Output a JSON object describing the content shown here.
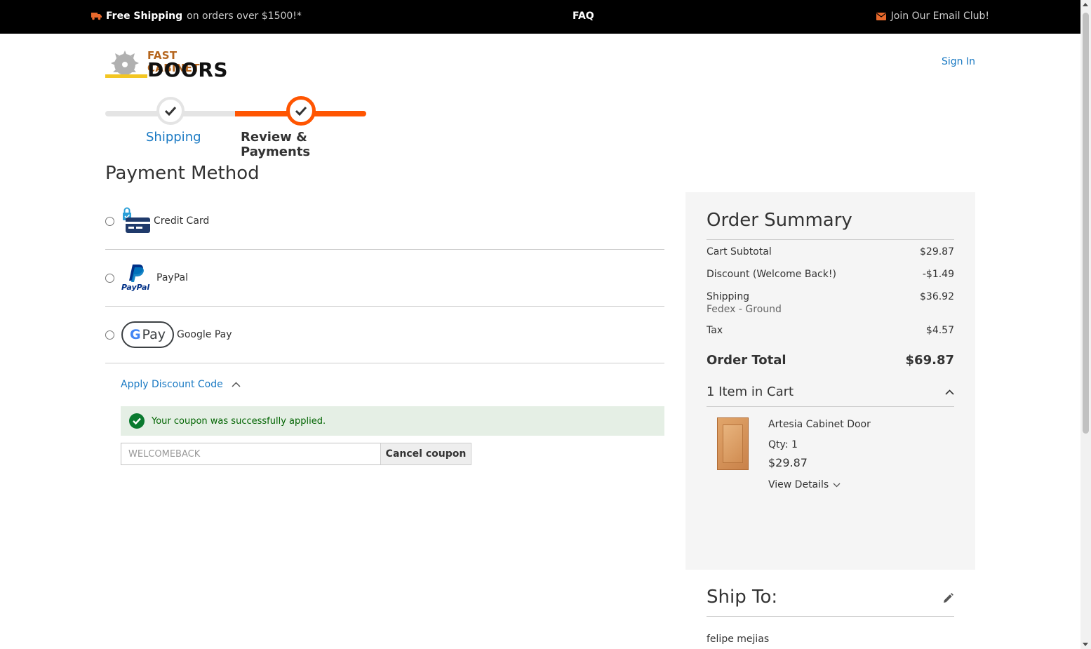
{
  "topbar": {
    "shipping_bold": "Free Shipping",
    "shipping_rest": "on orders over $1500!*",
    "faq": "FAQ",
    "email_club": "Join Our Email Club!"
  },
  "header": {
    "logo_line1": "FAST CABINET",
    "logo_line2": "DOORS",
    "sign_in": "Sign In"
  },
  "progress": {
    "steps": [
      {
        "label": "Shipping",
        "state": "complete"
      },
      {
        "label": "Review & Payments",
        "state": "active"
      }
    ]
  },
  "payment": {
    "title": "Payment Method",
    "methods": [
      {
        "label": "Credit Card",
        "icon": "credit-card-lock-icon"
      },
      {
        "label": "PayPal",
        "icon": "paypal-icon"
      },
      {
        "label": "Google Pay",
        "icon": "google-pay-icon"
      }
    ],
    "paypal_logo_text": "PayPal",
    "gpay_g": "G",
    "gpay_text": "Pay"
  },
  "discount": {
    "toggle_label": "Apply Discount Code",
    "success_message": "Your coupon was successfully applied.",
    "coupon_value": "WELCOMEBACK",
    "cancel_label": "Cancel coupon"
  },
  "summary": {
    "title": "Order Summary",
    "subtotal_label": "Cart Subtotal",
    "subtotal": "$29.87",
    "discount_label": "Discount (Welcome Back!)",
    "discount": "-$1.49",
    "shipping_label": "Shipping",
    "shipping_method": "Fedex - Ground",
    "shipping": "$36.92",
    "tax_label": "Tax",
    "tax": "$4.57",
    "total_label": "Order Total",
    "total": "$69.87",
    "items_count_label": "1 Item in Cart",
    "item": {
      "name": "Artesia Cabinet Door",
      "qty": "Qty: 1",
      "price": "$29.87",
      "view_details": "View Details"
    }
  },
  "ship_to": {
    "title": "Ship To:",
    "name": "felipe mejias"
  },
  "colors": {
    "accent": "#ff5501",
    "link": "#1979c3",
    "success_bg": "#e5efe5",
    "success_text": "#006400"
  }
}
